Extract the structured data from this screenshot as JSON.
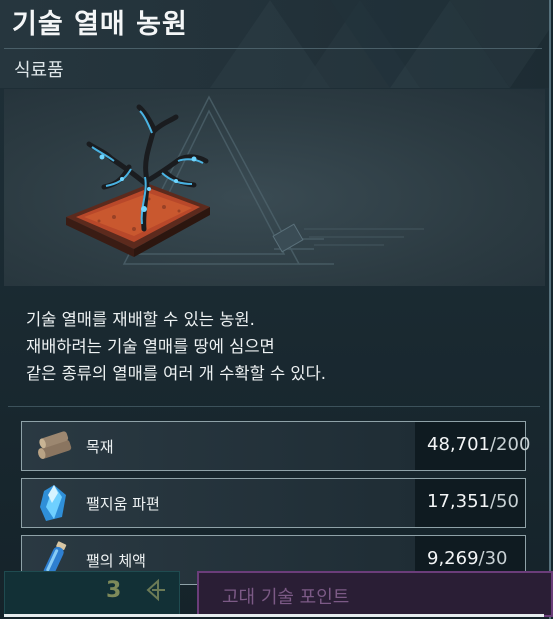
{
  "window": {
    "title": "기술 열매 농원",
    "category": "식료품"
  },
  "description": [
    "기술 열매를 재배할 수 있는 농원.",
    "재배하려는 기술 열매를 땅에 심으면",
    "같은 종류의 열매를 여러 개 수확할 수 있다."
  ],
  "materials": [
    {
      "name": "목재",
      "owned": "48,701",
      "required": "/200",
      "icon": "wood-log-icon"
    },
    {
      "name": "팰지움 파편",
      "owned": "17,351",
      "required": "/50",
      "icon": "paldium-fragment-icon"
    },
    {
      "name": "팰의 체액",
      "owned": "9,269",
      "required": "/30",
      "icon": "pal-fluid-icon"
    }
  ],
  "bottom_bar": {
    "count": "3",
    "ancient_points_label": "고대 기술 포인트"
  },
  "colors": {
    "panel_bg": "#1f3038",
    "accent_purple": "#6b3d7a",
    "accent_teal": "#1f4b50",
    "crystal_blue": "#4fc3f7"
  }
}
